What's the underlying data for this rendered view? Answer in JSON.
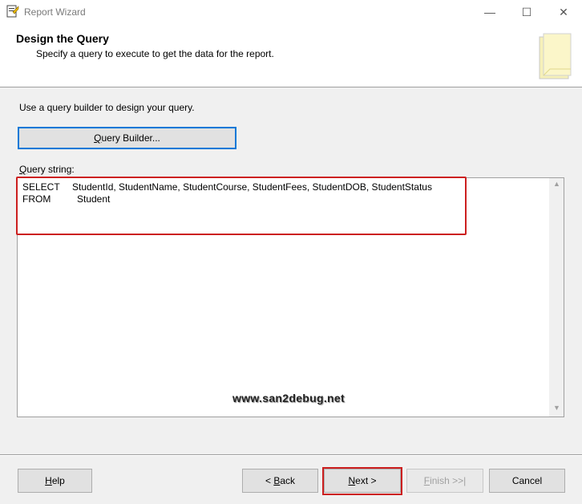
{
  "window": {
    "title": "Report Wizard",
    "minimize_glyph": "—",
    "maximize_glyph": "☐",
    "close_glyph": "✕"
  },
  "header": {
    "title": "Design the Query",
    "subtitle": "Specify a query to execute to get the data for the report."
  },
  "main": {
    "instruction": "Use a query builder to design your query.",
    "query_builder_button": {
      "prefix": "",
      "accel": "Q",
      "rest": "uery Builder..."
    },
    "query_string_label": {
      "accel": "Q",
      "rest": "uery string:"
    },
    "query_lines": [
      {
        "keyword": "SELECT",
        "text": "StudentId, StudentName, StudentCourse, StudentFees, StudentDOB, StudentStatus"
      },
      {
        "keyword": "FROM",
        "text": "Student"
      }
    ],
    "watermark": "www.san2debug.net"
  },
  "footer": {
    "help": {
      "accel": "H",
      "rest": "elp"
    },
    "back": {
      "prefix": "< ",
      "accel": "B",
      "rest": "ack"
    },
    "next": {
      "accel": "N",
      "rest": "ext >"
    },
    "finish": {
      "accel": "F",
      "rest": "inish >>|"
    },
    "cancel": "Cancel"
  },
  "colors": {
    "highlight": "#cc1f1f",
    "focus_border": "#0078d7"
  }
}
